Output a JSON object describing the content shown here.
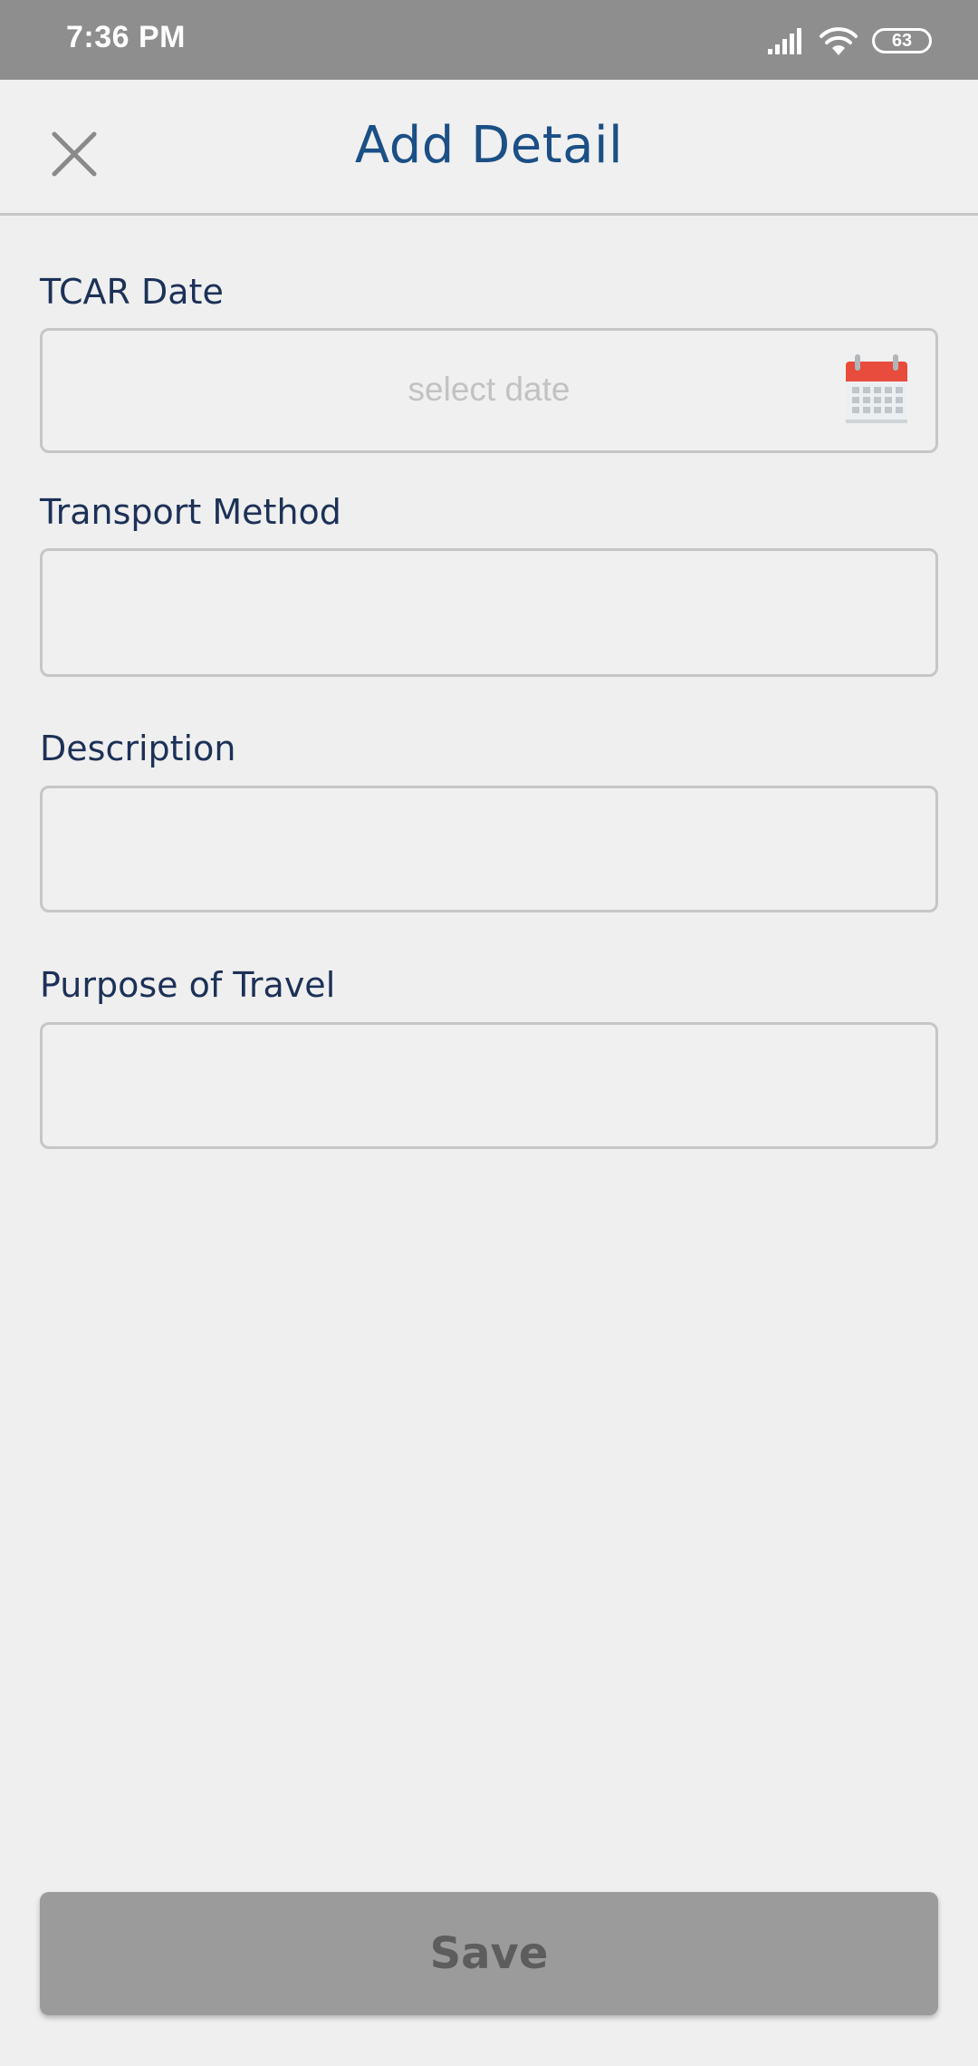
{
  "status_bar": {
    "time": "7:36 PM",
    "battery": "63"
  },
  "header": {
    "title": "Add Detail"
  },
  "form": {
    "tcar_date": {
      "label": "TCAR Date",
      "placeholder": "select date",
      "value": ""
    },
    "transport_method": {
      "label": "Transport Method",
      "value": ""
    },
    "description": {
      "label": "Description",
      "value": ""
    },
    "purpose_of_travel": {
      "label": "Purpose of Travel",
      "value": ""
    }
  },
  "footer": {
    "save_label": "Save"
  },
  "icons": {
    "close": "close-icon",
    "calendar": "calendar-icon",
    "signal": "signal-icon",
    "wifi": "wifi-icon"
  },
  "colors": {
    "accent": "#1b4f86",
    "label": "#1c3157",
    "calendar_red": "#e74c3c",
    "button_disabled": "#9b9b9b"
  }
}
